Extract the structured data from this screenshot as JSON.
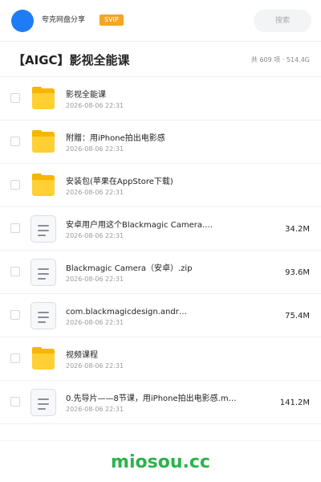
{
  "header": {
    "brand": "夸克网盘分享",
    "badge": "SVIP",
    "search_placeholder": "搜索"
  },
  "titlebar": {
    "title": "【AIGC】影视全能课",
    "summary": "共 609 项 · 514.4G"
  },
  "items": [
    {
      "type": "folder",
      "name": "影视全能课",
      "date": "2026-08-06 22:31",
      "size": ""
    },
    {
      "type": "folder",
      "name": "附赠：用iPhone拍出电影感",
      "date": "2026-08-06 22:31",
      "size": ""
    },
    {
      "type": "folder",
      "name": "安装包(苹果在AppStore下载)",
      "date": "2026-08-06 22:31",
      "size": ""
    },
    {
      "type": "file",
      "name": "安卓用户用这个Blackmagic Camera.…",
      "date": "2026-08-06 22:31",
      "size": "34.2M"
    },
    {
      "type": "file",
      "name": "Blackmagic Camera（安卓）.zip",
      "date": "2026-08-06 22:31",
      "size": "93.6M"
    },
    {
      "type": "file",
      "name": "com.blackmagicdesign.andr…",
      "date": "2026-08-06 22:31",
      "size": "75.4M"
    },
    {
      "type": "folder",
      "name": "视频课程",
      "date": "2026-08-06 22:31",
      "size": ""
    },
    {
      "type": "file",
      "name": "0.先导片——8节课，用iPhone拍出电影感.m…",
      "date": "2026-08-06 22:31",
      "size": "141.2M"
    }
  ],
  "footer": {
    "watermark": "miosou.cc"
  },
  "colors": {
    "accent": "#1f7cf5",
    "badge": "#f5a623",
    "folder": "#ffcf33",
    "watermark": "#2bb34a"
  }
}
